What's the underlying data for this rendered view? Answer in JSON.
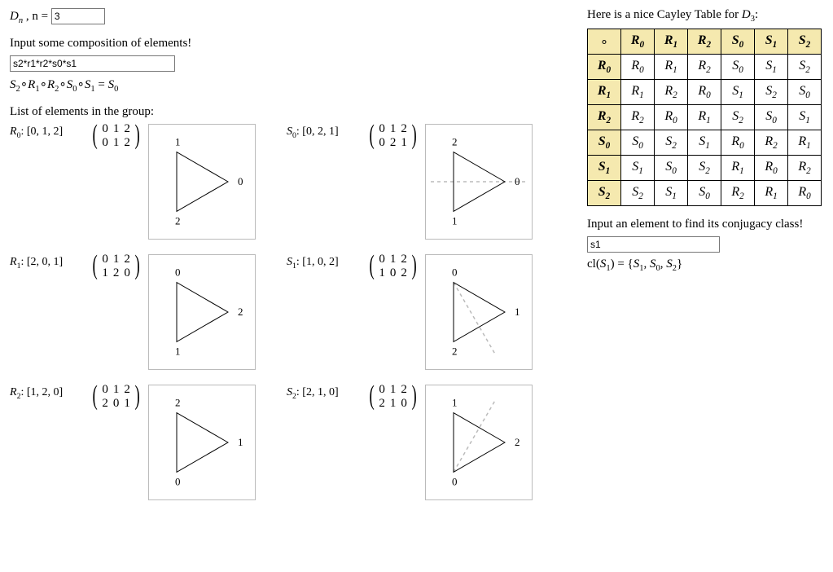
{
  "header": {
    "dn": "D",
    "n_label": ", n = ",
    "n_value": "3"
  },
  "comp": {
    "prompt": "Input some composition of elements!",
    "value": "s2*r1*r2*s0*s1",
    "result_lhs0": "S",
    "result_lhs0s": "2",
    "result_circ": "∘",
    "parts": [
      "S2",
      "R1",
      "R2",
      "S0",
      "S1"
    ],
    "eq": " = ",
    "result_rhs": "S",
    "result_rhs_s": "0"
  },
  "list_label": "List of elements in the group:",
  "elements": [
    {
      "name": "R",
      "sub": "0",
      "perm": "[0, 1, 2]",
      "mat": [
        "0",
        "1",
        "2",
        "0",
        "1",
        "2"
      ],
      "verts": [
        "1",
        "2",
        "0"
      ],
      "axis": null
    },
    {
      "name": "S",
      "sub": "0",
      "perm": "[0, 2, 1]",
      "mat": [
        "0",
        "1",
        "2",
        "0",
        "2",
        "1"
      ],
      "verts": [
        "2",
        "1",
        "0"
      ],
      "axis": "h"
    },
    {
      "name": "R",
      "sub": "1",
      "perm": "[2, 0, 1]",
      "mat": [
        "0",
        "1",
        "2",
        "1",
        "2",
        "0"
      ],
      "verts": [
        "0",
        "1",
        "2"
      ],
      "axis": null
    },
    {
      "name": "S",
      "sub": "1",
      "perm": "[1, 0, 2]",
      "mat": [
        "0",
        "1",
        "2",
        "1",
        "0",
        "2"
      ],
      "verts": [
        "0",
        "2",
        "1"
      ],
      "axis": "d1"
    },
    {
      "name": "R",
      "sub": "2",
      "perm": "[1, 2, 0]",
      "mat": [
        "0",
        "1",
        "2",
        "2",
        "0",
        "1"
      ],
      "verts": [
        "2",
        "0",
        "1"
      ],
      "axis": null
    },
    {
      "name": "S",
      "sub": "2",
      "perm": "[2, 1, 0]",
      "mat": [
        "0",
        "1",
        "2",
        "2",
        "1",
        "0"
      ],
      "verts": [
        "1",
        "0",
        "2"
      ],
      "axis": "d2"
    }
  ],
  "cayley": {
    "heading_pre": "Here is a nice Cayley Table for ",
    "heading_D": "D",
    "heading_sub": "3",
    "heading_post": ":",
    "header": [
      "R0",
      "R1",
      "R2",
      "S0",
      "S1",
      "S2"
    ],
    "rows": [
      {
        "h": "R0",
        "c": [
          "R0",
          "R1",
          "R2",
          "S0",
          "S1",
          "S2"
        ]
      },
      {
        "h": "R1",
        "c": [
          "R1",
          "R2",
          "R0",
          "S1",
          "S2",
          "S0"
        ]
      },
      {
        "h": "R2",
        "c": [
          "R2",
          "R0",
          "R1",
          "S2",
          "S0",
          "S1"
        ]
      },
      {
        "h": "S0",
        "c": [
          "S0",
          "S2",
          "S1",
          "R0",
          "R2",
          "R1"
        ]
      },
      {
        "h": "S1",
        "c": [
          "S1",
          "S0",
          "S2",
          "R1",
          "R0",
          "R2"
        ]
      },
      {
        "h": "S2",
        "c": [
          "S2",
          "S1",
          "S0",
          "R2",
          "R1",
          "R0"
        ]
      }
    ]
  },
  "conj": {
    "prompt": "Input an element to find its conjugacy class!",
    "value": "s1",
    "result_pre": "cl(",
    "result_el": "S",
    "result_el_s": "1",
    "result_mid": ") = {",
    "members": [
      "S1",
      "S0",
      "S2"
    ],
    "result_post": "}"
  }
}
